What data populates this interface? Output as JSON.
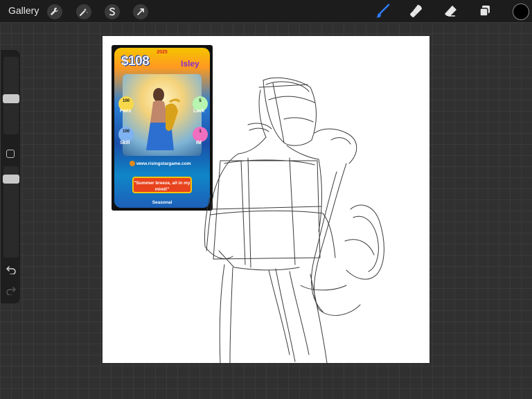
{
  "topbar": {
    "gallery_label": "Gallery",
    "left_tools": [
      "wrench-icon",
      "magic-wand-icon",
      "selection-icon",
      "transform-icon"
    ],
    "right_tools": [
      "brush-icon",
      "smudge-icon",
      "eraser-icon",
      "layers-icon"
    ],
    "active_tool": "brush-icon",
    "current_color": "#000000",
    "accent_color": "#2f7cf6"
  },
  "sidebar": {
    "brush_size_level": 0.5,
    "opacity_level": 0.35
  },
  "card": {
    "year": "2025",
    "price": "$108",
    "name": "Isley",
    "stats": {
      "fans_value": "100",
      "fans_label": "Fans",
      "luck_value": "5",
      "luck_label": "Luck",
      "skill_value": "100",
      "skill_label": "Skill",
      "im_value": "1",
      "im_label": "IM"
    },
    "url": "www.risingstargame.com",
    "quote": "\"Summer breeze, all in my mind!\"",
    "footer": "Seasonal"
  }
}
